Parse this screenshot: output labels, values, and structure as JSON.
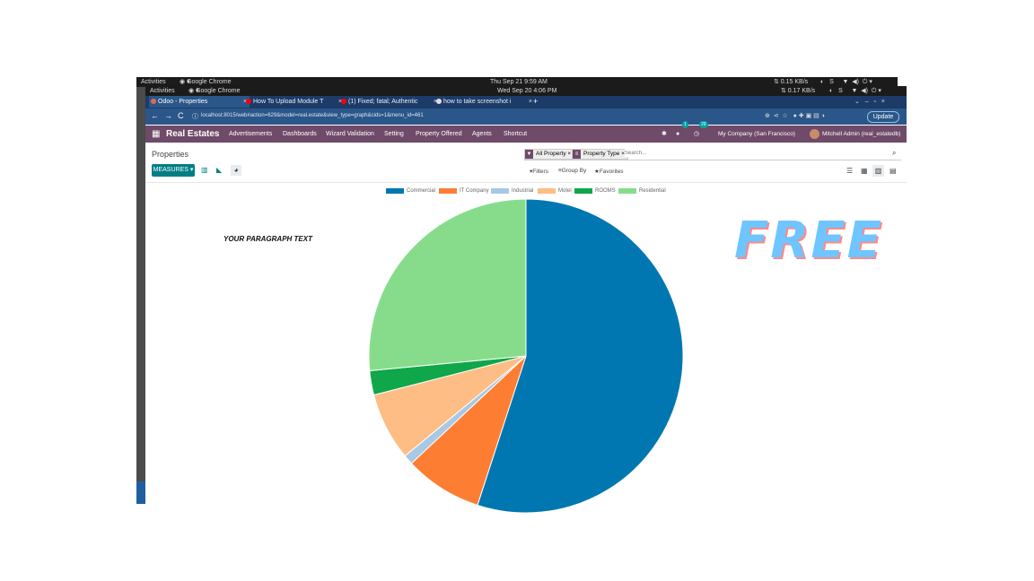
{
  "os": {
    "back": {
      "activities": "Activities",
      "app": "Google Chrome",
      "clock": "Thu Sep 21  9:59 AM",
      "net": "⇅ 0.15 KB/s"
    },
    "front": {
      "activities": "Activities",
      "app": "Google Chrome",
      "clock": "Wed Sep 20  4:06 PM",
      "net": "⇅ 0.17 KB/s"
    }
  },
  "browser": {
    "tabs": [
      {
        "label": "Odoo - Properties",
        "color": "#e06c4b"
      },
      {
        "label": "How To Upload Module T",
        "color": "#ff0000"
      },
      {
        "label": "(1) Fixed; fatal; Authentic",
        "color": "#ff0000"
      },
      {
        "label": "how to take screenshot i",
        "color": "#dddddd"
      }
    ],
    "new_tab": "+",
    "url": "localhost:8015/web#action=629&model=real.estate&view_type=graph&cids=1&menu_id=461",
    "update_label": "Update"
  },
  "odoo": {
    "app_name": "Real Estates",
    "menu": [
      "Advertisements",
      "Dashboards",
      "Wizard Validation",
      "Setting",
      "Property Offered",
      "Agents",
      "Shortcut"
    ],
    "chat_badge": "1",
    "activity_badge": "29",
    "company": "My Company (San Francisco)",
    "user": "Mitchell Admin (real_estatedb)",
    "breadcrumb": "Properties",
    "facets": [
      "All Property",
      "Property Type"
    ],
    "search_placeholder": "Search...",
    "measures_label": "MEASURES ▾",
    "filters_label": "Filters",
    "groupby_label": "Group By",
    "favorites_label": "Favorites"
  },
  "overlay": {
    "paragraph": "YOUR PARAGRAPH TEXT",
    "free": "FREE"
  },
  "chart_data": {
    "type": "pie",
    "categories": [
      "Commercial",
      "IT Company",
      "Industrial",
      "Motel",
      "ROOMS",
      "Residential"
    ],
    "values": [
      55,
      8,
      1,
      7,
      2.5,
      26.5
    ],
    "colors": [
      "#0177b1",
      "#fd7e33",
      "#a8c8e4",
      "#fdbd84",
      "#10a64a",
      "#87dc8c"
    ],
    "legend_position": "top"
  }
}
